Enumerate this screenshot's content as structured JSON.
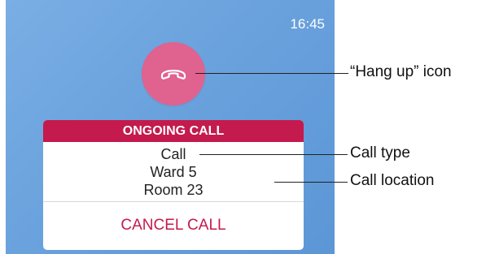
{
  "status_bar": {
    "time": "16:45"
  },
  "hangup": {
    "icon": "phone-hangup-icon"
  },
  "call_card": {
    "header": "ONGOING CALL",
    "call_type": "Call",
    "ward": "Ward 5",
    "room": "Room 23",
    "cancel_label": "CANCEL CALL"
  },
  "annotations": {
    "hangup_icon": "“Hang up” icon",
    "call_type": "Call type",
    "call_location": "Call location"
  },
  "colors": {
    "screen_background": "#6aa2dd",
    "hangup_button": "#e0628e",
    "header_background": "#c41a4d",
    "cancel_text": "#c41a4d"
  }
}
